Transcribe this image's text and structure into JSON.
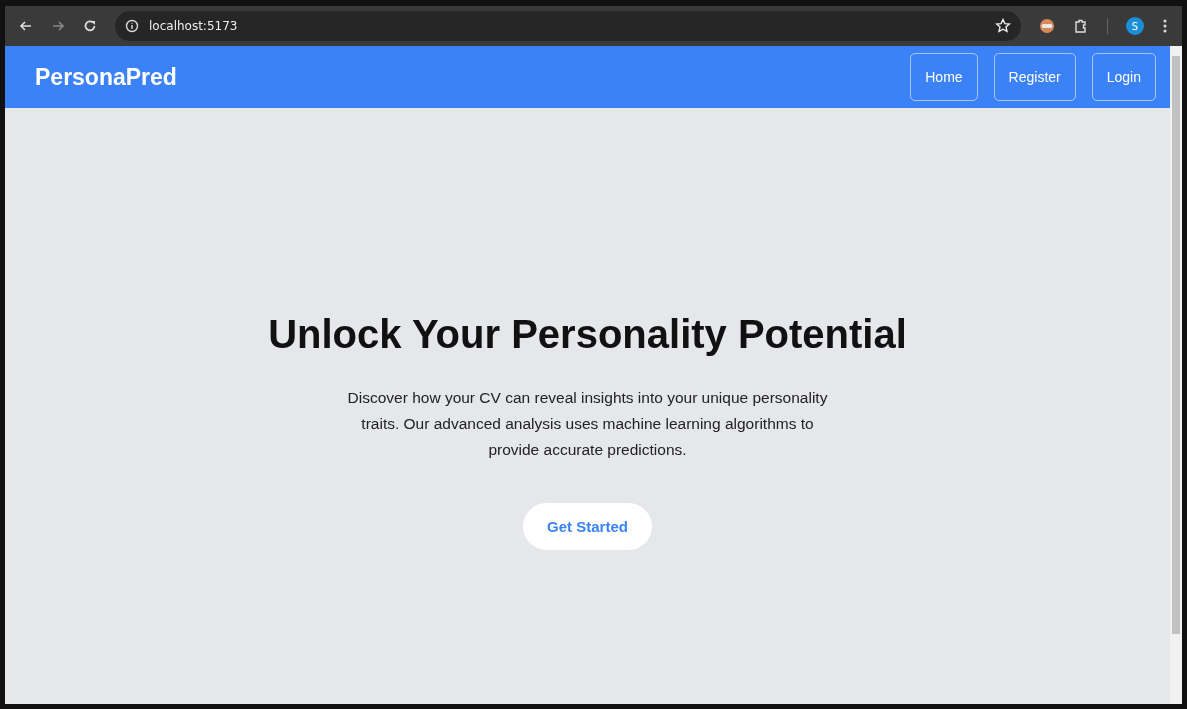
{
  "browser": {
    "url": "localhost:5173",
    "profile_initial": "S"
  },
  "navbar": {
    "brand": "PersonaPred",
    "links": [
      {
        "label": "Home"
      },
      {
        "label": "Register"
      },
      {
        "label": "Login"
      }
    ]
  },
  "hero": {
    "title": "Unlock Your Personality Potential",
    "description": "Discover how your CV can reveal insights into your unique personality traits. Our advanced analysis uses machine learning algorithms to provide accurate predictions.",
    "button": "Get Started"
  }
}
